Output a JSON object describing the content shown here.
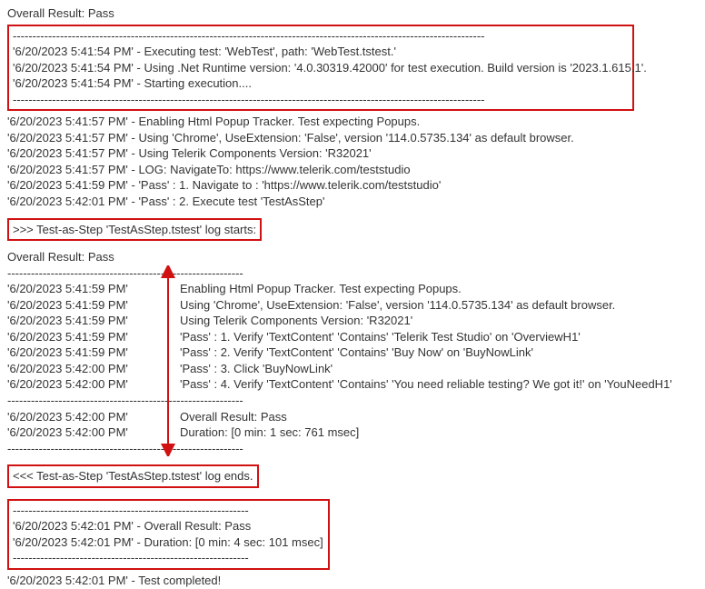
{
  "overall_result_top": "Overall Result: Pass",
  "dashes_short": "------------------------------------------------------------",
  "dashes_long": "------------------------------------------------------------------------------------------------------------------------",
  "box1": {
    "l1": "'6/20/2023 5:41:54 PM' - Executing test: 'WebTest', path: 'WebTest.tstest.'",
    "l2": "'6/20/2023 5:41:54 PM' - Using .Net Runtime version: '4.0.30319.42000' for test execution. Build version is '2023.1.615.1'.",
    "l3": "'6/20/2023 5:41:54 PM' - Starting execution....",
    "dashes": "------------------------------------------------------------------------------------------------------------------------"
  },
  "midlines": {
    "l1": "'6/20/2023 5:41:57 PM' - Enabling Html Popup Tracker. Test expecting Popups.",
    "l2": "'6/20/2023 5:41:57 PM' - Using 'Chrome', UseExtension: 'False', version '114.0.5735.134' as default browser.",
    "l3": "'6/20/2023 5:41:57 PM' - Using Telerik Components Version: 'R32021'",
    "l4": "'6/20/2023 5:41:57 PM' - LOG: NavigateTo: https://www.telerik.com/teststudio",
    "l5": "'6/20/2023 5:41:59 PM' - 'Pass' : 1. Navigate to : 'https://www.telerik.com/teststudio'",
    "l6": "'6/20/2023 5:42:01 PM' - 'Pass' : 2. Execute test 'TestAsStep'"
  },
  "log_starts": ">>> Test-as-Step 'TestAsStep.tstest' log starts:",
  "inner_overall": "Overall Result: Pass",
  "inner": [
    {
      "ts": "'6/20/2023 5:41:59 PM'",
      "msg": "Enabling Html Popup Tracker. Test expecting Popups."
    },
    {
      "ts": "'6/20/2023 5:41:59 PM'",
      "msg": "Using 'Chrome', UseExtension: 'False', version '114.0.5735.134' as default browser."
    },
    {
      "ts": "'6/20/2023 5:41:59 PM'",
      "msg": "Using Telerik Components Version: 'R32021'"
    },
    {
      "ts": "'6/20/2023 5:41:59 PM'",
      "msg": "'Pass' : 1. Verify 'TextContent' 'Contains' 'Telerik Test Studio' on 'OverviewH1'"
    },
    {
      "ts": "'6/20/2023 5:41:59 PM'",
      "msg": "'Pass' : 2. Verify 'TextContent' 'Contains' 'Buy Now' on 'BuyNowLink'"
    },
    {
      "ts": "'6/20/2023 5:42:00 PM'",
      "msg": "'Pass' : 3. Click 'BuyNowLink'"
    },
    {
      "ts": "'6/20/2023 5:42:00 PM'",
      "msg": "'Pass' : 4. Verify 'TextContent' 'Contains' 'You need reliable testing? We got it!' on 'YouNeedH1'"
    }
  ],
  "inner_tail": [
    {
      "ts": "'6/20/2023 5:42:00 PM'",
      "msg": "Overall Result: Pass"
    },
    {
      "ts": "'6/20/2023 5:42:00 PM'",
      "msg": "Duration: [0 min: 1 sec: 761 msec]"
    }
  ],
  "log_ends": "<<< Test-as-Step 'TestAsStep.tstest' log ends.",
  "box_final": {
    "dashes": "------------------------------------------------------------",
    "l1": "'6/20/2023 5:42:01 PM' - Overall Result: Pass",
    "l2": "'6/20/2023 5:42:01 PM' - Duration: [0 min: 4 sec: 101 msec]"
  },
  "completed": "'6/20/2023 5:42:01 PM' - Test completed!"
}
